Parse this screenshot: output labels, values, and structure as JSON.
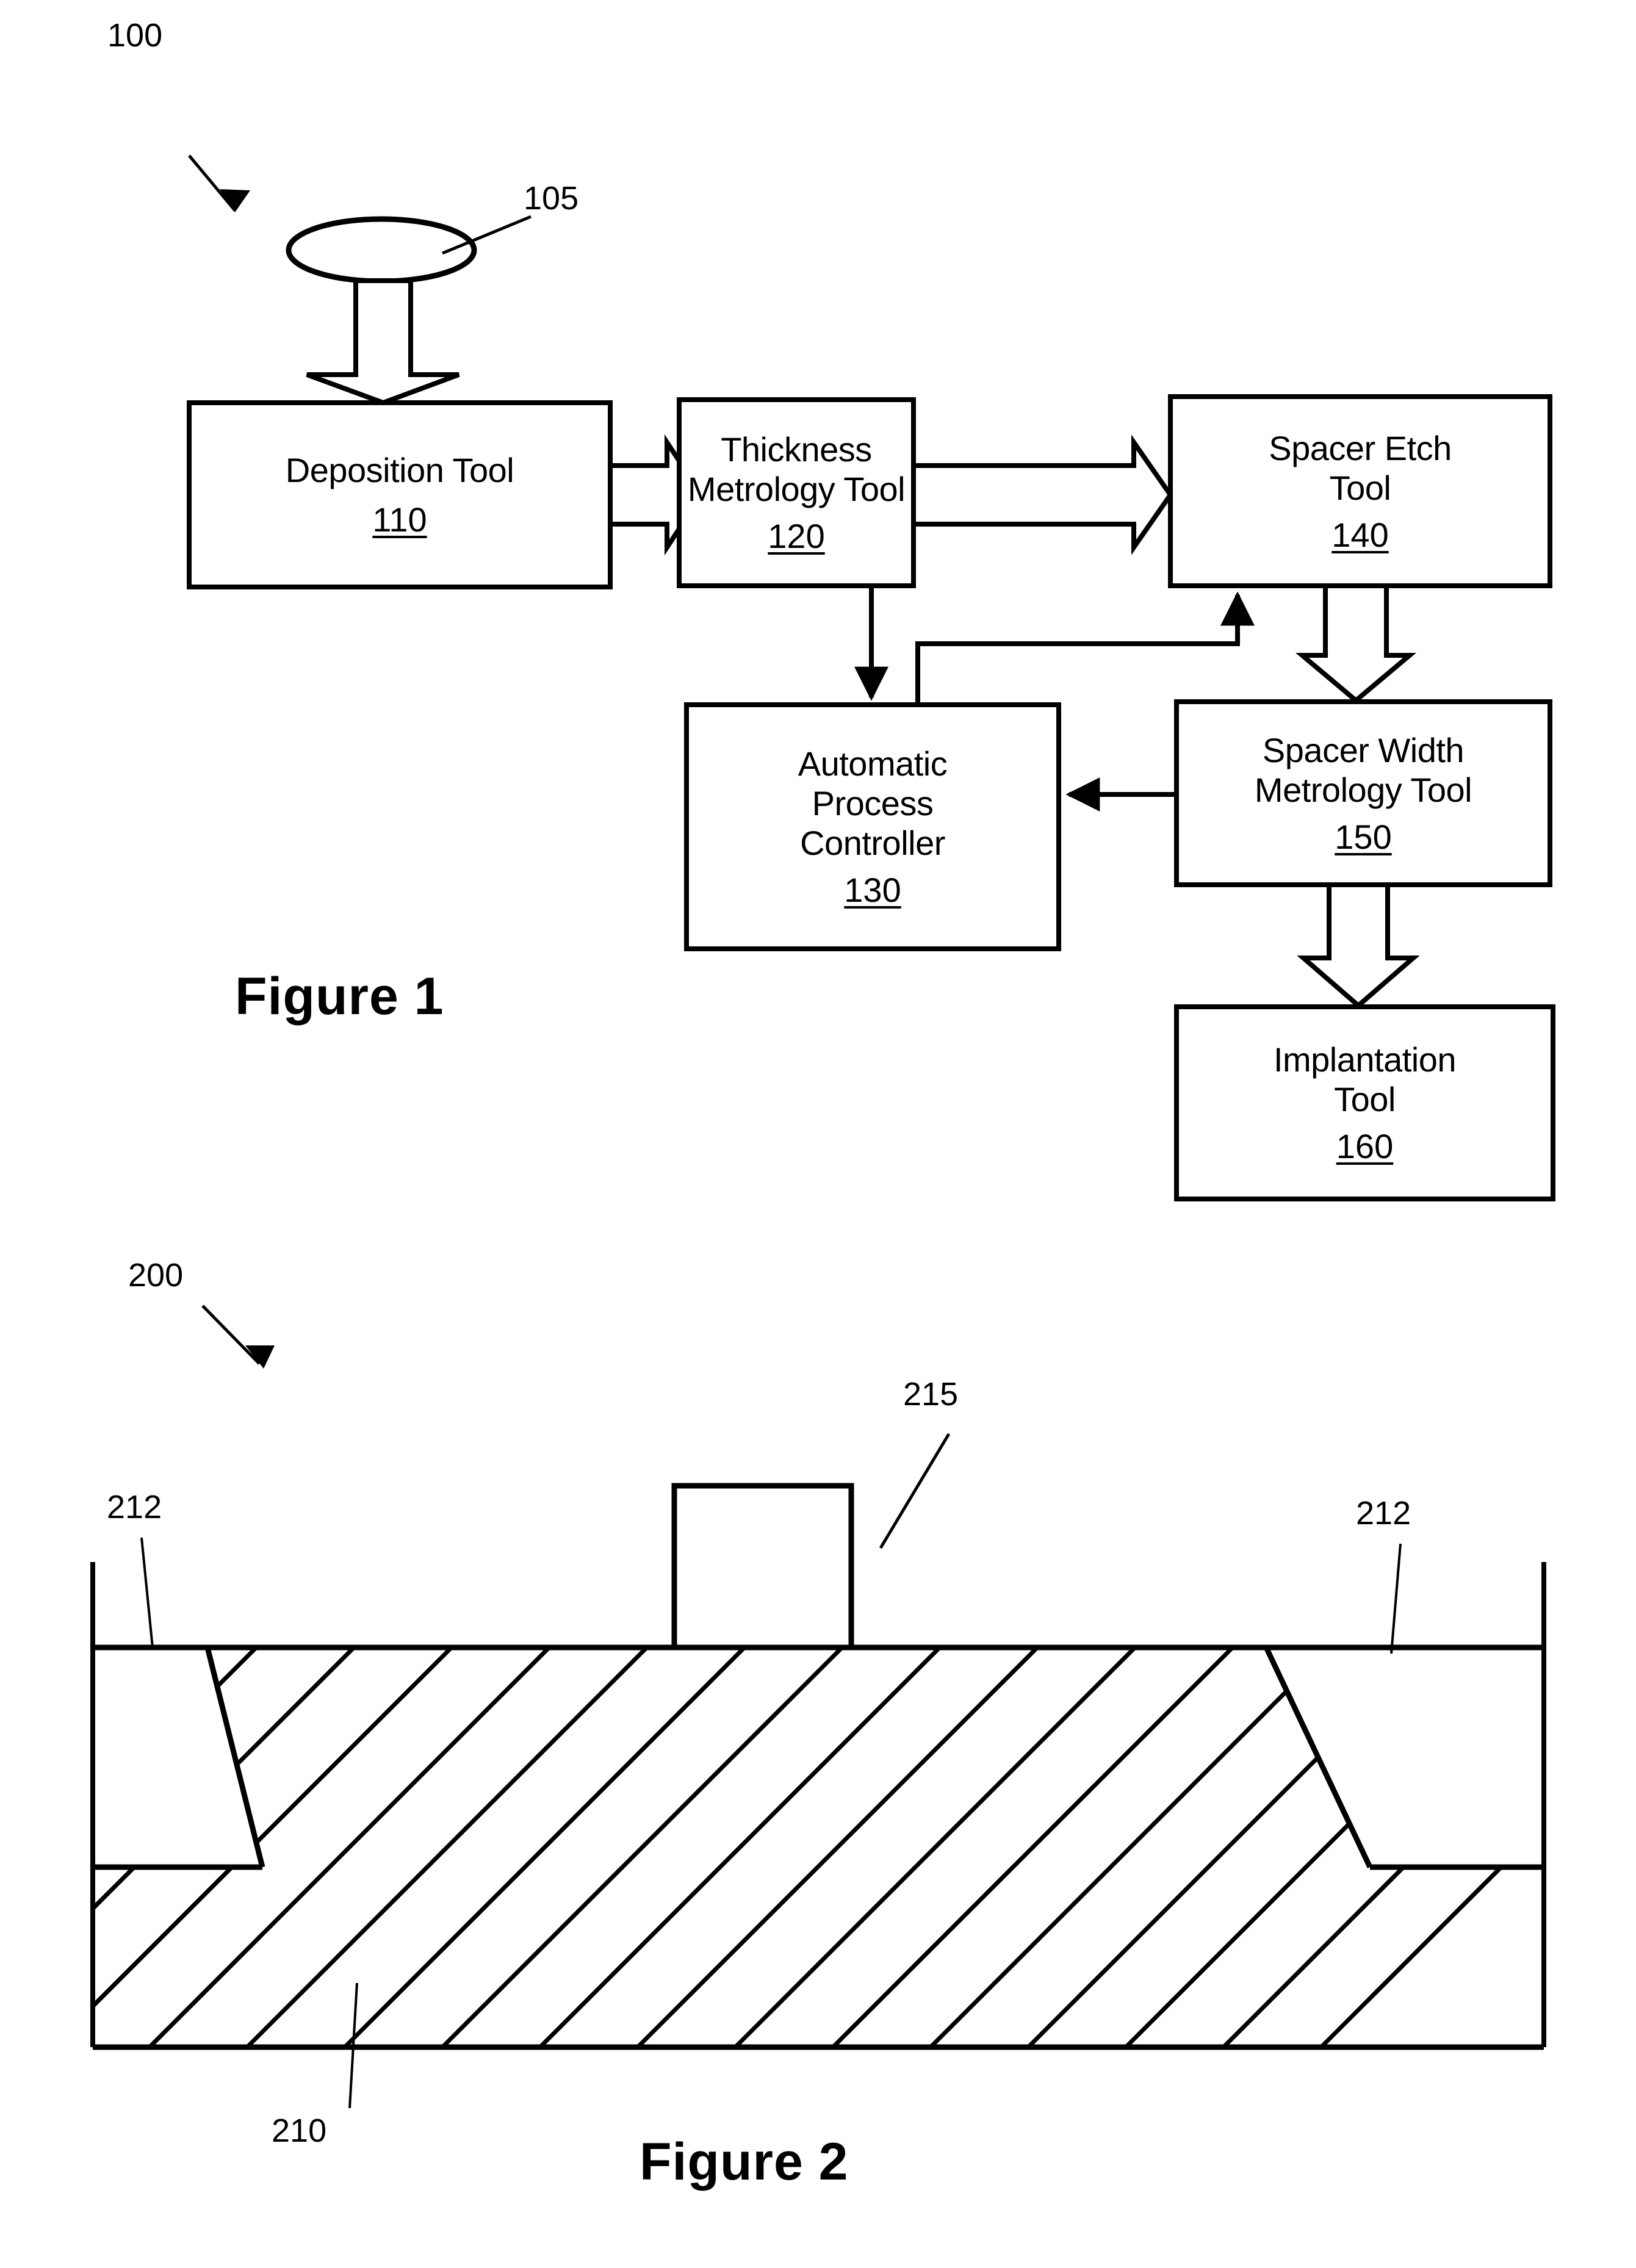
{
  "document": {
    "type": "patent-drawing-sheet",
    "figures": [
      {
        "caption": "Figure 1",
        "system_ref": "100",
        "nodes": [
          {
            "ref": "105",
            "label": "",
            "kind": "wafer-ellipse"
          },
          {
            "ref": "110",
            "label": "Deposition Tool"
          },
          {
            "ref": "120",
            "label": "Thickness\nMetrology Tool"
          },
          {
            "ref": "140",
            "label": "Spacer Etch\nTool"
          },
          {
            "ref": "130",
            "label": "Automatic\nProcess\nController"
          },
          {
            "ref": "150",
            "label": "Spacer Width\nMetrology Tool"
          },
          {
            "ref": "160",
            "label": "Implantation\nTool"
          }
        ]
      },
      {
        "caption": "Figure 2",
        "system_ref": "200",
        "refs": [
          "210",
          "212",
          "212",
          "215"
        ]
      }
    ]
  },
  "fig1": {
    "caption": "Figure 1",
    "system_ref": "100",
    "wafer_ref": "105",
    "boxes": {
      "deposition": {
        "line1": "Deposition Tool",
        "num": "110"
      },
      "thickness": {
        "line1": "Thickness",
        "line2": "Metrology Tool",
        "num": "120"
      },
      "spacer_etch": {
        "line1": "Spacer Etch",
        "line2": "Tool",
        "num": "140"
      },
      "apc": {
        "line1": "Automatic",
        "line2": "Process",
        "line3": "Controller",
        "num": "130"
      },
      "spacer_width": {
        "line1": "Spacer Width",
        "line2": "Metrology Tool",
        "num": "150"
      },
      "implant": {
        "line1": "Implantation",
        "line2": "Tool",
        "num": "160"
      }
    }
  },
  "fig2": {
    "caption": "Figure 2",
    "system_ref": "200",
    "ref_substrate": "210",
    "ref_layer_left": "212",
    "ref_layer_right": "212",
    "ref_gate": "215"
  },
  "colors": {
    "ink": "#000000",
    "paper": "#ffffff"
  }
}
